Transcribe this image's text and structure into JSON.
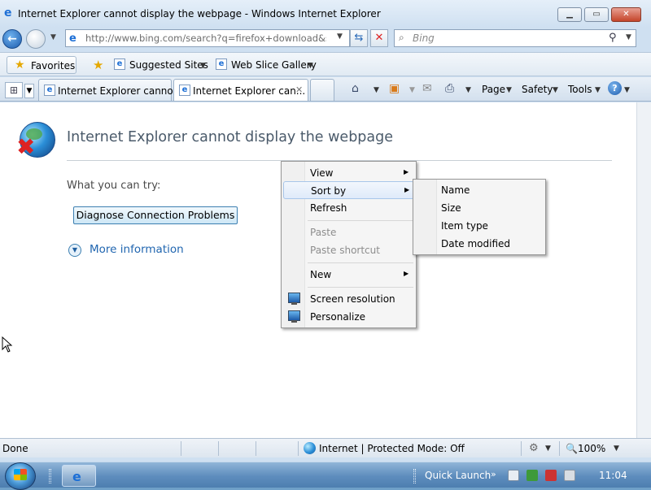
{
  "window": {
    "title": "Internet Explorer cannot display the webpage - Windows Internet Explorer",
    "minimize_icon": "minimize-icon",
    "maximize_icon": "maximize-icon",
    "close_icon": "close-icon"
  },
  "address_bar": {
    "url": "http://www.bing.com/search?q=firefox+download&src=",
    "icons": [
      "back-icon",
      "forward-icon",
      "refresh-icon",
      "stop-icon"
    ]
  },
  "search": {
    "placeholder": "Bing"
  },
  "favorites_bar": {
    "favorites_label": "Favorites",
    "links": [
      {
        "label": "Suggested Sites"
      },
      {
        "label": "Web Slice Gallery"
      }
    ]
  },
  "tabs": [
    {
      "label": "Internet Explorer cannot ..."
    },
    {
      "label": "Internet Explorer can..."
    }
  ],
  "command_bar": {
    "page_label": "Page",
    "safety_label": "Safety",
    "tools_label": "Tools",
    "help_label": "?"
  },
  "content": {
    "heading": "Internet Explorer cannot display the webpage",
    "try_label": "What you can try:",
    "diagnose_button": "Diagnose Connection Problems",
    "more_info": "More information"
  },
  "context_menu": {
    "items": [
      {
        "label": "View",
        "has_submenu": true
      },
      {
        "label": "Sort by",
        "has_submenu": true,
        "highlighted": true
      },
      {
        "label": "Refresh"
      },
      {
        "label": "Paste",
        "disabled": true
      },
      {
        "label": "Paste shortcut",
        "disabled": true
      },
      {
        "label": "New",
        "has_submenu": true
      },
      {
        "label": "Screen resolution",
        "icon": "monitor-icon"
      },
      {
        "label": "Personalize",
        "icon": "monitor-icon"
      }
    ],
    "sort_by_submenu": [
      "Name",
      "Size",
      "Item type",
      "Date modified"
    ]
  },
  "status_bar": {
    "status": "Done",
    "zone": "Internet | Protected Mode: Off",
    "zoom": "100%"
  },
  "taskbar": {
    "quick_launch": "Quick Launch",
    "clock": "11:04"
  },
  "colors": {
    "heading_text": "#4a5a6a",
    "link": "#2166b0",
    "menu_highlight": "#dfeafa",
    "taskbar": "#5e8dbd"
  }
}
